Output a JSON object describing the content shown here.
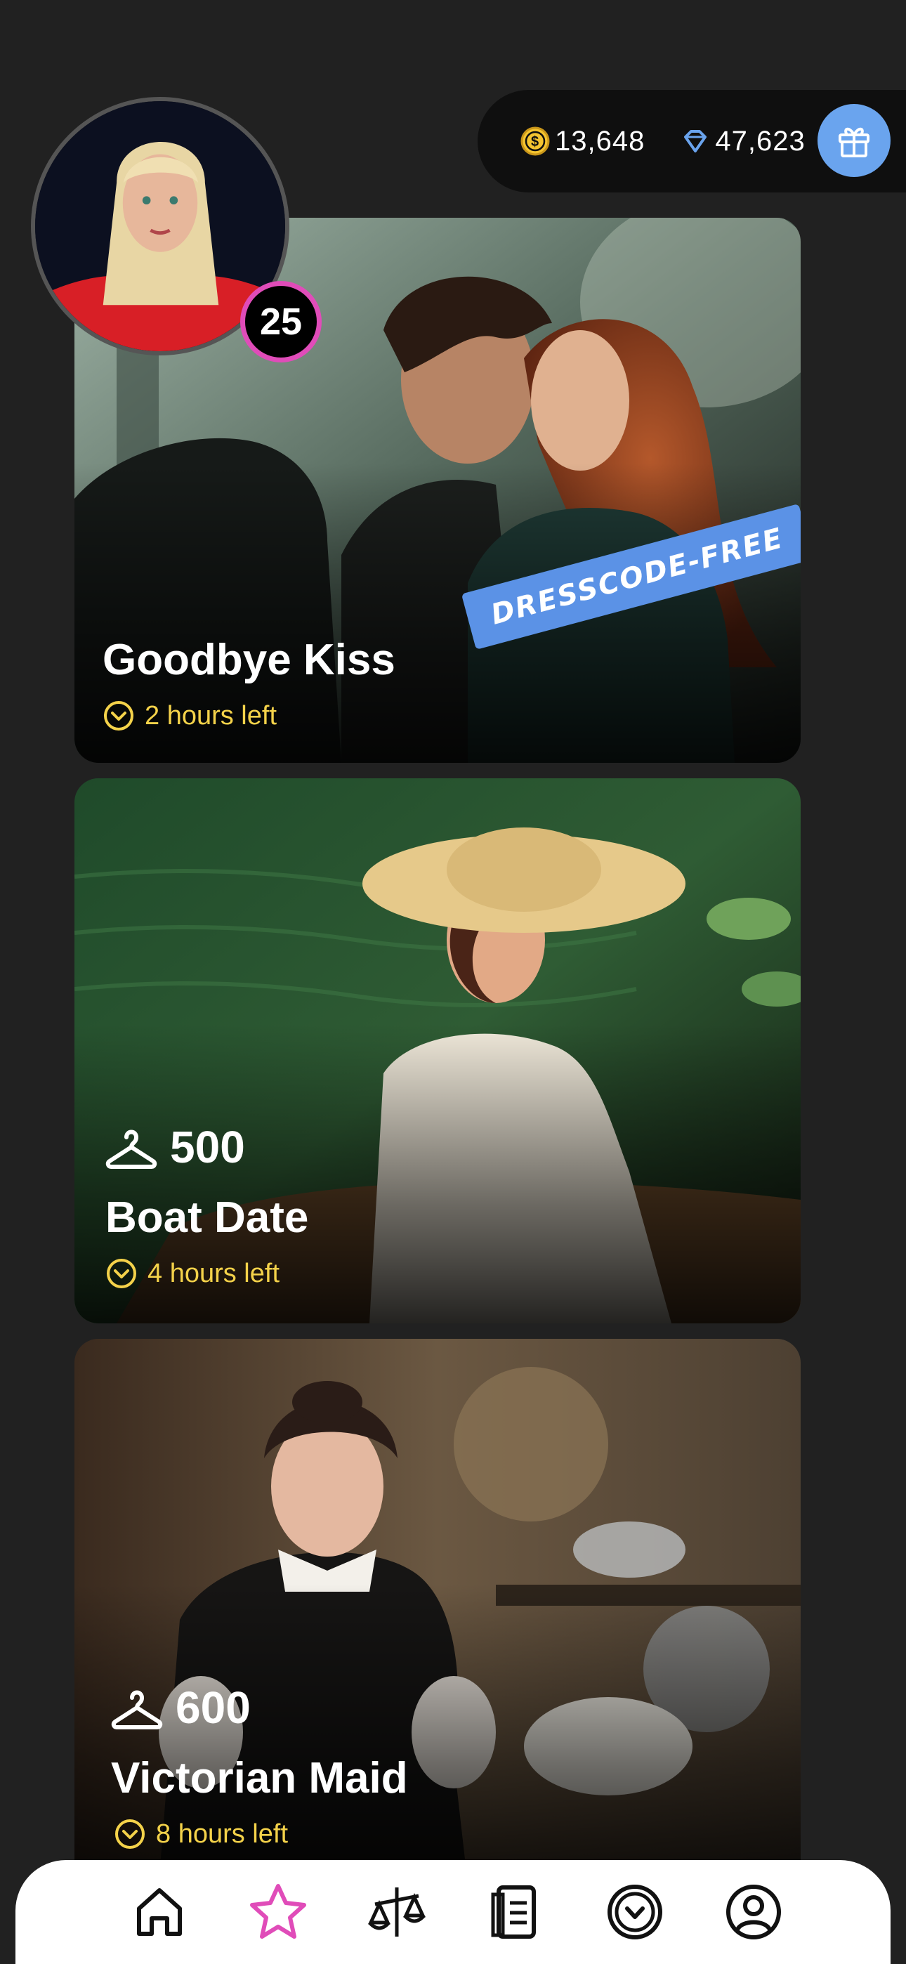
{
  "currency": {
    "coins": "13,648",
    "gems": "47,623",
    "coin_icon": "coin-icon",
    "gem_icon": "diamond-icon",
    "gift_icon": "gift-icon"
  },
  "player": {
    "level": "25"
  },
  "events": [
    {
      "title": "Goodbye Kiss",
      "time_left": "2 hours left",
      "tag": "DRESSCODE-FREE"
    },
    {
      "title": "Boat Date",
      "time_left": "4 hours left",
      "price": "500"
    },
    {
      "title": "Victorian Maid",
      "time_left": "8 hours left",
      "price": "600"
    }
  ],
  "nav": {
    "items": [
      "home-icon",
      "star-icon",
      "scales-icon",
      "document-icon",
      "clock-icon",
      "profile-icon"
    ],
    "active": "star-icon"
  },
  "colors": {
    "background": "#212121",
    "accent_time": "#f4d24a",
    "accent_blue": "#6aa4ee",
    "accent_pink": "#e04cb9"
  }
}
